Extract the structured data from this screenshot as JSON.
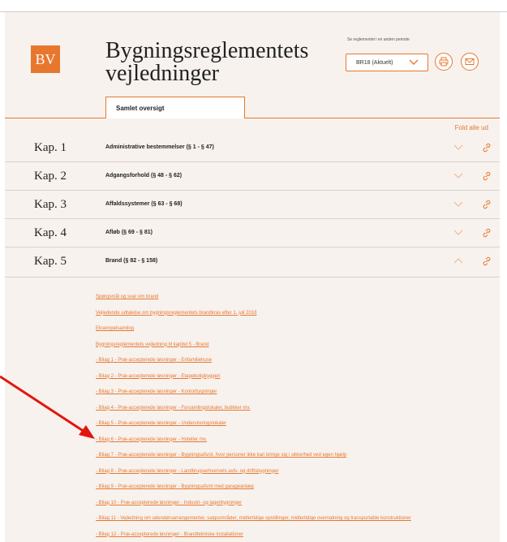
{
  "logo": {
    "text": "BV"
  },
  "title": "Bygningsreglementets vejledninger",
  "period": {
    "label": "Se reglementet i en anden periode",
    "selected": "BR18 (Aktuelt)"
  },
  "icons": {
    "print": "printer-icon",
    "mail": "mail-icon",
    "expand": "chevron-down-icon",
    "collapse": "chevron-up-icon",
    "link": "link-icon"
  },
  "tab": {
    "label": "Samlet oversigt"
  },
  "fold_all": "Fold alle ud",
  "chapters": [
    {
      "kap": "Kap. 1",
      "name": "Administrative bestemmelser (§ 1 - § 47)",
      "expanded": false
    },
    {
      "kap": "Kap. 2",
      "name": "Adgangsforhold (§ 48 - § 62)",
      "expanded": false
    },
    {
      "kap": "Kap. 3",
      "name": "Affaldssystemer (§ 63 - § 68)",
      "expanded": false
    },
    {
      "kap": "Kap. 4",
      "name": "Afløb (§ 69 - § 81)",
      "expanded": false
    },
    {
      "kap": "Kap. 5",
      "name": "Brand (§ 82 - § 158)",
      "expanded": true
    }
  ],
  "brand_links": [
    "Spørgsmål og svar om brand",
    "Vejledende udtalelse om bygningsreglementets brandkrav efter 1. juli 2018",
    "Eksempelsamling",
    "Bygningsreglementets vejledning til kapitel 5 - Brand",
    "- Bilag 1 - Præ-accepterede løsninger - Enfamiliehuse",
    "- Bilag 2 - Præ-accepterede løsninger - Etageboligbyggeri",
    "- Bilag 3 - Præ-accepterede løsninger - Kontorbygninger",
    "- Bilag 4 - Præ-accepterede løsninger - Forsamlingslokaler, butikker mv.",
    "- Bilag 5 - Præ-accepterede løsninger - Undervisningslokaler",
    "- Bilag 6 - Præ-accepterede løsninger - Hoteller mv.",
    "- Bilag 7 - Præ-accepterede løsninger - Bygningsafsnit, hvor personer ikke kan bringe sig i sikkerhed ved egen hjælp",
    "- Bilag 8 - Præ-accepterede løsninger - Landbrugserhvervets avls- og driftsbygninger",
    "- Bilag 9 - Præ-accepterede løsninger - Bygningsafsnit med garageanlæg",
    "- Bilag 10 - Præ-accepterede løsninger - Industri- og lagerbygninger",
    "- Bilag 11 - Vejledning om udendørsarrangementer, salgsområder, midlertidige opstillinger, midlertidige overnatning og transportable konstruktioner",
    "- Bilag 12 - Præ-accepterede løsninger - Brandtekniske installationer"
  ],
  "colors": {
    "accent": "#e8772e",
    "annotation_arrow": "#e3150f",
    "background": "#f7f2ee"
  }
}
